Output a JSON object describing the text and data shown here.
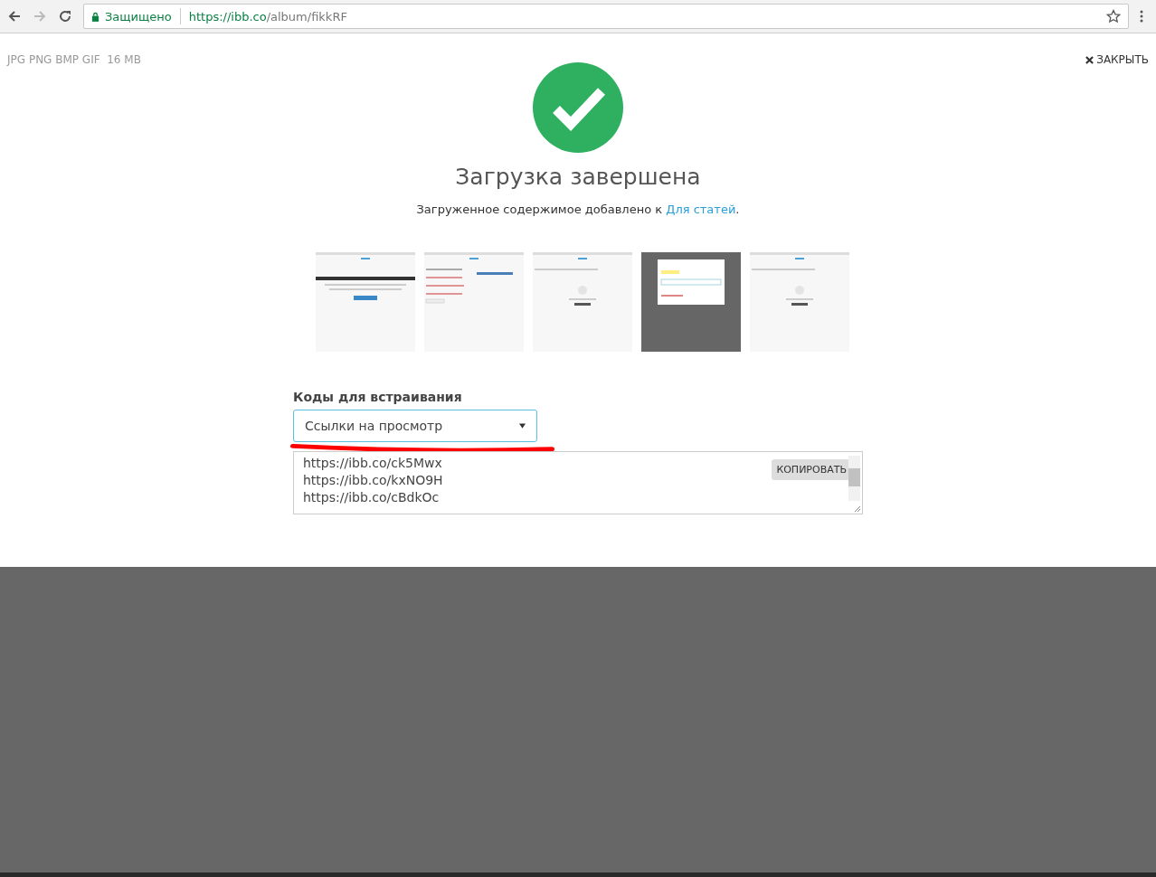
{
  "browser": {
    "secure_label": "Защищено",
    "url_host": "https://ibb.co",
    "url_path": "/album/fikkRF"
  },
  "formats": "JPG PNG BMP GIF  16 MB",
  "close": "ЗАКРЫТЬ",
  "title": "Загрузка завершена",
  "message": {
    "text": "Загруженное содержимое добавлено к ",
    "link": "Для статей",
    "after": "."
  },
  "thumbnails": [
    {
      "kind": "hero"
    },
    {
      "kind": "form"
    },
    {
      "kind": "empty"
    },
    {
      "kind": "dialog"
    },
    {
      "kind": "empty"
    }
  ],
  "embed": {
    "label": "Коды для встраивания",
    "select_value": "Ссылки на просмотр",
    "copy_button": "КОПИРОВАТЬ",
    "links": [
      "https://ibb.co/ck5Mwx",
      "https://ibb.co/kxNO9H",
      "https://ibb.co/cBdkOc"
    ]
  }
}
